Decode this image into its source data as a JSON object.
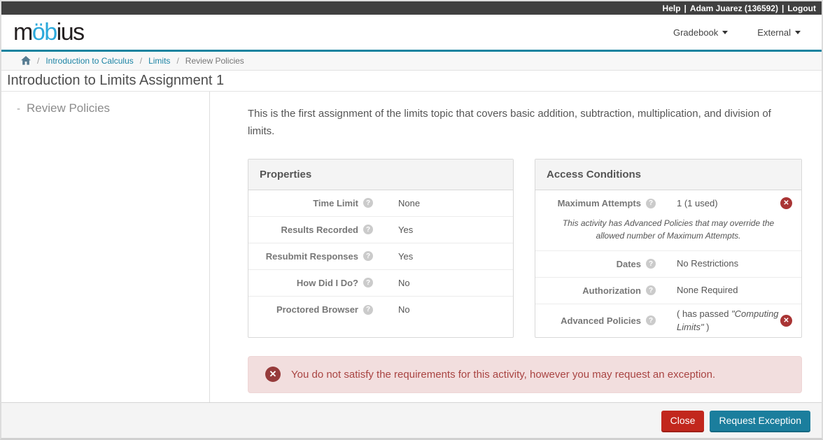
{
  "topbar": {
    "separator": "|",
    "links": [
      "Help",
      "Adam Juarez (136592)",
      "Logout"
    ]
  },
  "header": {
    "logo": {
      "pre": "m",
      "mid": "öb",
      "post": "ius"
    },
    "nav": [
      {
        "label": "Gradebook"
      },
      {
        "label": "External"
      }
    ]
  },
  "breadcrumb": {
    "separator": "/",
    "links": [
      "Introduction to Calculus",
      "Limits"
    ],
    "current": "Review Policies"
  },
  "page": {
    "title": "Introduction to Limits Assignment 1"
  },
  "sidebar": {
    "items": [
      {
        "marker": "-",
        "label": "Review Policies"
      }
    ]
  },
  "main": {
    "description": "This is the first assignment of the limits topic that covers basic addition, subtraction, multiplication, and division of limits.",
    "properties": {
      "title": "Properties",
      "rows": [
        {
          "label": "Time Limit",
          "value": "None"
        },
        {
          "label": "Results Recorded",
          "value": "Yes"
        },
        {
          "label": "Resubmit Responses",
          "value": "Yes"
        },
        {
          "label": "How Did I Do?",
          "value": "No"
        },
        {
          "label": "Proctored Browser",
          "value": "No"
        }
      ]
    },
    "access": {
      "title": "Access Conditions",
      "rows": [
        {
          "label": "Maximum Attempts",
          "value": "1 (1 used)",
          "note": "This activity has Advanced Policies that may override the allowed number of Maximum Attempts."
        },
        {
          "label": "Dates",
          "value": "No Restrictions"
        },
        {
          "label": "Authorization",
          "value": "None Required"
        },
        {
          "label": "Advanced Policies",
          "value_open": "( has passed ",
          "value_italic": "\"Computing Limits\"",
          "value_close": " )"
        }
      ]
    },
    "alert": {
      "text": "You do not satisfy the requirements for this activity, however you may request an exception."
    }
  },
  "footer": {
    "buttons": [
      {
        "label": "Close"
      },
      {
        "label": "Request Exception"
      }
    ]
  },
  "colors": {
    "teal": "#17839f",
    "logo_accent": "#2ca9db",
    "close_red": "#c2271d",
    "request_teal": "#1b7e9d",
    "alert_bg": "#f2dede",
    "alert_text": "#a94442",
    "flag_red": "#a93434"
  }
}
